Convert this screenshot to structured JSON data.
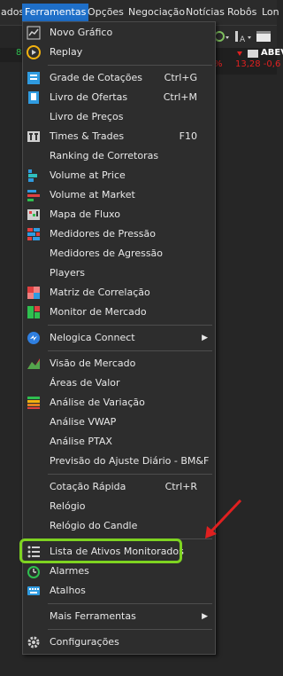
{
  "menubar": {
    "items": [
      {
        "label": "ados",
        "active": false
      },
      {
        "label": "Ferramentas",
        "active": true
      },
      {
        "label": "Opções",
        "active": false
      },
      {
        "label": "Negociação",
        "active": false
      },
      {
        "label": "Notícias",
        "active": false
      },
      {
        "label": "Robôs",
        "active": false
      },
      {
        "label": "Lon",
        "active": false
      }
    ]
  },
  "left_strip": {
    "text": "8"
  },
  "ticker": {
    "symbol": "ABEV",
    "price_line": "13,28 -0,6",
    "pct": "%"
  },
  "menu": {
    "items": [
      {
        "type": "item",
        "label": "Novo Gráfico",
        "icon": "chart-icon",
        "shortcut": ""
      },
      {
        "type": "item",
        "label": "Replay",
        "icon": "replay-icon",
        "shortcut": ""
      },
      {
        "type": "sep"
      },
      {
        "type": "item",
        "label": "Grade de Cotações",
        "icon": "quote-grid-icon",
        "shortcut": "Ctrl+G"
      },
      {
        "type": "item",
        "label": "Livro de Ofertas",
        "icon": "order-book-icon",
        "shortcut": "Ctrl+M"
      },
      {
        "type": "item",
        "label": "Livro de Preços",
        "icon": "",
        "shortcut": ""
      },
      {
        "type": "item",
        "label": "Times & Trades",
        "icon": "times-trades-icon",
        "shortcut": "F10"
      },
      {
        "type": "item",
        "label": "Ranking de Corretoras",
        "icon": "",
        "shortcut": ""
      },
      {
        "type": "item",
        "label": "Volume at Price",
        "icon": "volume-price-icon",
        "shortcut": ""
      },
      {
        "type": "item",
        "label": "Volume at Market",
        "icon": "volume-market-icon",
        "shortcut": ""
      },
      {
        "type": "item",
        "label": "Mapa de Fluxo",
        "icon": "flow-map-icon",
        "shortcut": ""
      },
      {
        "type": "item",
        "label": "Medidores de Pressão",
        "icon": "pressure-icon",
        "shortcut": ""
      },
      {
        "type": "item",
        "label": "Medidores de Agressão",
        "icon": "",
        "shortcut": ""
      },
      {
        "type": "item",
        "label": "Players",
        "icon": "",
        "shortcut": ""
      },
      {
        "type": "item",
        "label": "Matriz de Correlação",
        "icon": "correlation-icon",
        "shortcut": ""
      },
      {
        "type": "item",
        "label": "Monitor de Mercado",
        "icon": "market-monitor-icon",
        "shortcut": ""
      },
      {
        "type": "sep"
      },
      {
        "type": "item",
        "label": "Nelogica Connect",
        "icon": "connect-icon",
        "shortcut": "",
        "submenu": true
      },
      {
        "type": "sep"
      },
      {
        "type": "item",
        "label": "Visão de Mercado",
        "icon": "market-view-icon",
        "shortcut": ""
      },
      {
        "type": "item",
        "label": "Áreas de Valor",
        "icon": "",
        "shortcut": ""
      },
      {
        "type": "item",
        "label": "Análise de Variação",
        "icon": "variation-icon",
        "shortcut": ""
      },
      {
        "type": "item",
        "label": "Análise VWAP",
        "icon": "",
        "shortcut": ""
      },
      {
        "type": "item",
        "label": "Análise PTAX",
        "icon": "",
        "shortcut": ""
      },
      {
        "type": "item",
        "label": "Previsão do Ajuste Diário - BM&F",
        "icon": "",
        "shortcut": ""
      },
      {
        "type": "sep"
      },
      {
        "type": "item",
        "label": "Cotação Rápida",
        "icon": "",
        "shortcut": "Ctrl+R"
      },
      {
        "type": "item",
        "label": "Relógio",
        "icon": "",
        "shortcut": ""
      },
      {
        "type": "item",
        "label": "Relógio do Candle",
        "icon": "",
        "shortcut": ""
      },
      {
        "type": "sep"
      },
      {
        "type": "item",
        "label": "Lista de Ativos Monitorados",
        "icon": "list-icon",
        "shortcut": ""
      },
      {
        "type": "item",
        "label": "Alarmes",
        "icon": "alarm-icon",
        "shortcut": ""
      },
      {
        "type": "item",
        "label": "Atalhos",
        "icon": "keyboard-icon",
        "shortcut": ""
      },
      {
        "type": "sep"
      },
      {
        "type": "item",
        "label": "Mais Ferramentas",
        "icon": "",
        "shortcut": "",
        "submenu": true
      },
      {
        "type": "sep"
      },
      {
        "type": "item",
        "label": "Configurações",
        "icon": "gear-icon",
        "shortcut": ""
      }
    ]
  },
  "colors": {
    "highlight": "#7ed321",
    "annotation_arrow": "#e02020",
    "active_menu": "#1f6fc8"
  }
}
